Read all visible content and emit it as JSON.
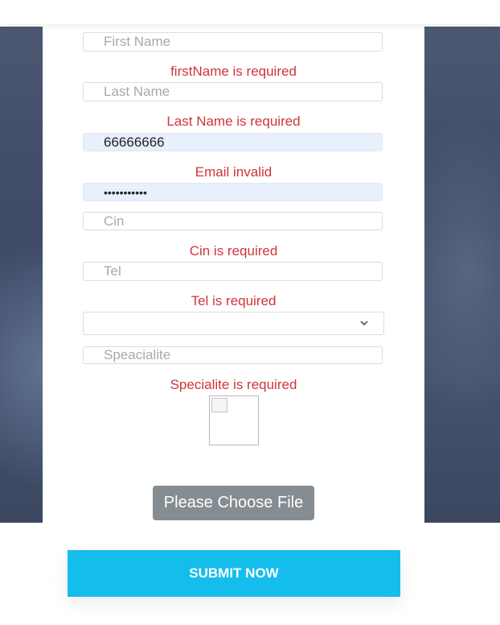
{
  "form": {
    "first_name": {
      "placeholder": "First Name",
      "error": "firstName is required"
    },
    "last_name": {
      "placeholder": "Last Name",
      "error": "Last Name is required"
    },
    "email": {
      "value": "66666666",
      "error": "Email invalid"
    },
    "password": {
      "value": "•••••••••••"
    },
    "cin": {
      "placeholder": "Cin",
      "error": "Cin is required"
    },
    "tel": {
      "placeholder": "Tel",
      "error": "Tel is required"
    },
    "select": {
      "value": "",
      "icon": "chevron-down-icon"
    },
    "specialite": {
      "placeholder": "Speacialite",
      "error": "Specialite is required"
    },
    "file_button_label": "Please Choose File"
  },
  "submit_label": "SUBMIT NOW",
  "colors": {
    "error": "#d0343a",
    "submit": "#15bdec",
    "file_button": "#858d92",
    "autofill": "#e8f0fe"
  }
}
